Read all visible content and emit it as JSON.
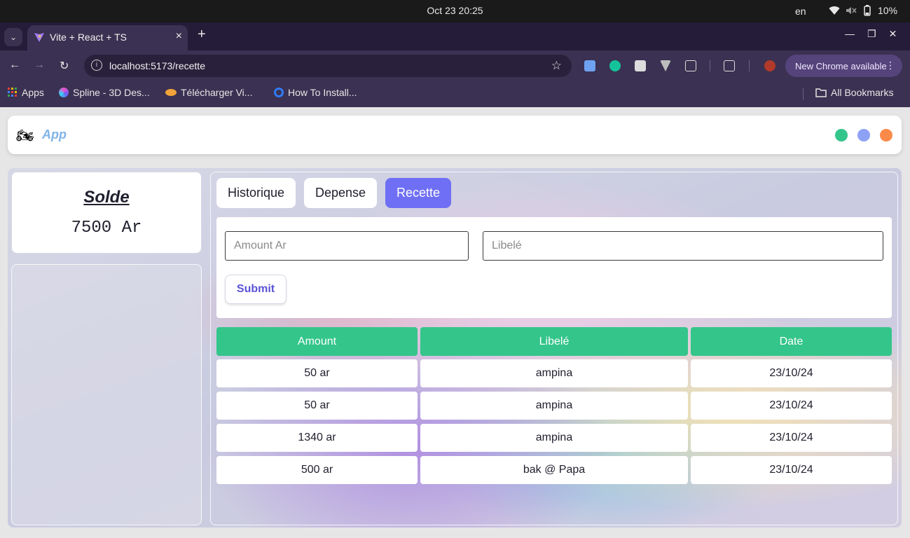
{
  "os": {
    "clock": "Oct 23  20:25",
    "lang": "en",
    "battery": "10%"
  },
  "browser": {
    "tab_title": "Vite + React + TS",
    "url": "localhost:5173/recette",
    "new_chrome": "New Chrome available",
    "bookmarks": [
      {
        "label": "Apps"
      },
      {
        "label": "Spline - 3D Des..."
      },
      {
        "label": "Télécharger Vi..."
      },
      {
        "label": "How To Install..."
      }
    ],
    "all_bookmarks": "All Bookmarks"
  },
  "app": {
    "logo": "App",
    "status_colors": [
      "#34c58b",
      "#8ea2f5",
      "#fb8a4a"
    ]
  },
  "solde": {
    "title": "Solde",
    "amount": "7500 Ar"
  },
  "tabs": [
    {
      "label": "Historique",
      "active": false
    },
    {
      "label": "Depense",
      "active": false
    },
    {
      "label": "Recette",
      "active": true
    }
  ],
  "form": {
    "amount_placeholder": "Amount Ar",
    "label_placeholder": "Libelé",
    "submit": "Submit"
  },
  "table": {
    "headers": [
      "Amount",
      "Libelé",
      "Date"
    ],
    "rows": [
      [
        "50 ar",
        "ampina",
        "23/10/24"
      ],
      [
        "50 ar",
        "ampina",
        "23/10/24"
      ],
      [
        "1340 ar",
        "ampina",
        "23/10/24"
      ],
      [
        "500 ar",
        "bak @ Papa",
        "23/10/24"
      ]
    ]
  }
}
